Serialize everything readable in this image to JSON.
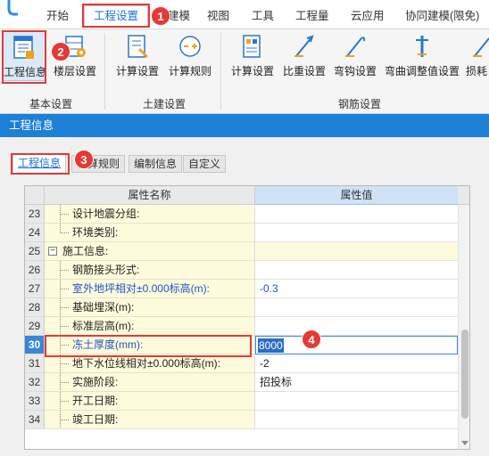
{
  "ribbon_tabs": [
    {
      "label": "开始"
    },
    {
      "label": "工程设置"
    },
    {
      "label": "建模"
    },
    {
      "label": "视图"
    },
    {
      "label": "工具"
    },
    {
      "label": "工程量"
    },
    {
      "label": "云应用"
    },
    {
      "label": "协同建模(限免)"
    }
  ],
  "ribbon": {
    "buttons": [
      {
        "label": "工程信息",
        "icon": "project-info-icon"
      },
      {
        "label": "楼层设置",
        "icon": "floor-settings-icon"
      },
      {
        "label": "计算设置",
        "icon": "calc-settings-icon"
      },
      {
        "label": "计算规则",
        "icon": "calc-rules-icon"
      },
      {
        "label": "计算设置",
        "icon": "rebar-calc-settings-icon"
      },
      {
        "label": "比重设置",
        "icon": "density-settings-icon"
      },
      {
        "label": "弯钩设置",
        "icon": "hook-settings-icon"
      },
      {
        "label": "弯曲调整值设置",
        "icon": "bend-adjust-icon"
      },
      {
        "label": "损耗",
        "icon": "loss-icon"
      }
    ],
    "groups": [
      {
        "label": "基本设置"
      },
      {
        "label": "土建设置"
      },
      {
        "label": "钢筋设置"
      }
    ]
  },
  "dialog": {
    "title": "工程信息",
    "tabs": [
      {
        "label": "工程信息"
      },
      {
        "label": "计算规则"
      },
      {
        "label": "编制信息"
      },
      {
        "label": "自定义"
      }
    ],
    "grid": {
      "header_name": "属性名称",
      "header_value": "属性值",
      "rows": [
        {
          "num": "23",
          "name": "设计地震分组:",
          "value": ""
        },
        {
          "num": "24",
          "name": "环境类别:",
          "value": ""
        },
        {
          "num": "25",
          "name": "施工信息:",
          "value": ""
        },
        {
          "num": "26",
          "name": "钢筋接头形式:",
          "value": ""
        },
        {
          "num": "27",
          "name": "室外地坪相对±0.000标高(m):",
          "value": "-0.3"
        },
        {
          "num": "28",
          "name": "基础埋深(m):",
          "value": ""
        },
        {
          "num": "29",
          "name": "标准层高(m):",
          "value": ""
        },
        {
          "num": "30",
          "name": "冻土厚度(mm):",
          "value": "8000"
        },
        {
          "num": "31",
          "name": "地下水位线相对±0.000标高(m):",
          "value": "-2"
        },
        {
          "num": "32",
          "name": "实施阶段:",
          "value": "招投标"
        },
        {
          "num": "33",
          "name": "开工日期:",
          "value": ""
        },
        {
          "num": "34",
          "name": "竣工日期:",
          "value": ""
        }
      ],
      "expander_symbol": "−"
    }
  },
  "annotations": [
    {
      "number": "1"
    },
    {
      "number": "2"
    },
    {
      "number": "3"
    },
    {
      "number": "4"
    }
  ],
  "colors": {
    "accent": "#1e7fd6",
    "highlight_red": "#e53935",
    "name_cell_bg": "#fdfbdc",
    "value_header_bg": "#cfe2f6",
    "blue_text": "#2255c4"
  }
}
